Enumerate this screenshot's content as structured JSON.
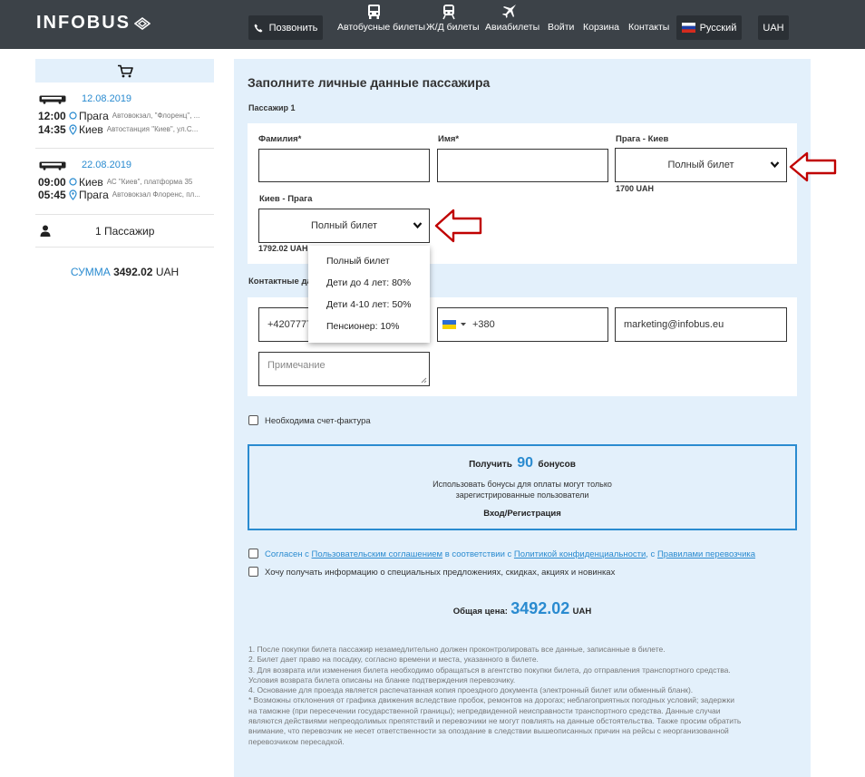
{
  "header": {
    "logo": "INFOBUS",
    "call_label": "Позвонить",
    "nav": {
      "bus": "Автобусные билеты",
      "train": "Ж/Д билеты",
      "air": "Авиабилеты",
      "login": "Войти",
      "cart": "Корзина",
      "contacts": "Контакты"
    },
    "language": "Русский",
    "currency": "UAH"
  },
  "sidebar": {
    "trips": [
      {
        "date": "12.08.2019",
        "departure": {
          "time": "12:00",
          "city": "Прага",
          "address": "Автовокзал, \"Флоренц\", ..."
        },
        "arrival": {
          "time": "14:35",
          "city": "Киев",
          "address": "Автостанция \"Киев\", ул.С..."
        }
      },
      {
        "date": "22.08.2019",
        "departure": {
          "time": "09:00",
          "city": "Киев",
          "address": "АС \"Киев\", платформа 35"
        },
        "arrival": {
          "time": "05:45",
          "city": "Прага",
          "address": "Автовокзал Флоренс, пл..."
        }
      }
    ],
    "passengers": "1 Пассажир",
    "sum_label": "СУММА",
    "sum_value": "3492.02",
    "sum_currency": "UAH"
  },
  "form": {
    "title": "Заполните личные данные пассажира",
    "passenger_title": "Пассажир 1",
    "surname_label": "Фамилия*",
    "name_label": "Имя*",
    "route1_label": "Прага - Киев",
    "route1_ticket": "Полный билет",
    "route1_price": "1700 UAH",
    "route2_label": "Киев - Прага",
    "route2_ticket": "Полный билет",
    "route2_price": "1792.02 UAH",
    "dropdown_options": [
      "Полный билет",
      "Дети до 4 лет: 80%",
      "Дети 4-10 лет: 50%",
      "Пенсионер: 10%"
    ],
    "contact_title_visible": "Контактные да",
    "phone1_value": "+4207777",
    "phone2_value": "+380",
    "email_value": "marketing@infobus.eu",
    "note_placeholder": "Примечание",
    "invoice_label": "Необходима счет-фактура"
  },
  "bonus": {
    "get": "Получить",
    "amount": "90",
    "bonuses": "бонусов",
    "line1": "Использовать бонусы для оплаты могут только",
    "line2": "зарегистрированные пользователи",
    "login": "Вход/Регистрация"
  },
  "agree": {
    "p1": "Согласен с ",
    "l1": "Пользовательским соглашением",
    "p2": " в соответствии с ",
    "l2": "Политикой конфиденциальности",
    "p3": ", с ",
    "l3": "Правилами перевозчика",
    "newsletter": "Хочу получать информацию о специальных предложениях, скидках, акциях и новинках"
  },
  "total": {
    "label": "Общая цена:",
    "value": "3492.02",
    "currency": "UAH"
  },
  "notes": [
    "1. После покупки билета пассажир незамедлительно должен проконтролировать все данные, записанные в билете.",
    "2. Билет дает право на посадку, согласно времени и места, указанного в билете.",
    "3. Для возврата или изменения билета необходимо обращаться в агентство покупки билета, до отправления транспортного средства.",
    "Условия возврата билета описаны на бланке подтверждения перевозчику.",
    "4. Основание для проезда является распечатанная копия проездного документа (электронный билет или обменный бланк).",
    "* Возможны отклонения от графика движения вследствие пробок, ремонтов на дорогах; неблагоприятных погодных условий; задержки",
    "на таможне (при пересечении государственной границы); непредвиденной неисправности транспортного средства. Данные случаи",
    "являются действиями непреодолимых препятствий и перевозчики не могут повлиять на данные обстоятельства. Также просим обратить",
    "внимание, что перевозчик не несет ответственности за опоздание в следствии вышеописанных причин на рейсы с неорганизованной",
    "перевозчиком пересадкой."
  ],
  "colors": {
    "header_bg": "#3c4248",
    "accent": "#2a8bd0",
    "panel_bg": "#e3f0fb",
    "annotation_arrow": "#c00000"
  }
}
